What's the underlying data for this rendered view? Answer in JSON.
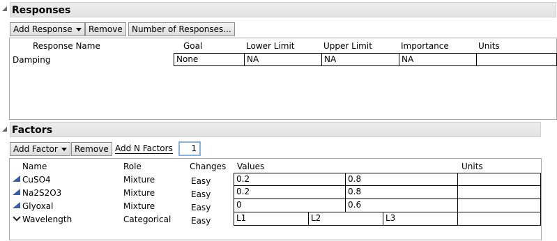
{
  "responses": {
    "title": "Responses",
    "add_label": "Add Response",
    "remove_label": "Remove",
    "number_label": "Number of Responses...",
    "columns": [
      "Response Name",
      "Goal",
      "Lower Limit",
      "Upper Limit",
      "Importance",
      "Units"
    ],
    "rows": [
      {
        "name": "Damping",
        "goal": "None",
        "lower": "NA",
        "upper": "NA",
        "importance": "NA",
        "units": ""
      }
    ]
  },
  "factors": {
    "title": "Factors",
    "add_label": "Add Factor",
    "remove_label": "Remove",
    "add_n_label": "Add N Factors",
    "add_n_value": "1",
    "columns": [
      "Name",
      "Role",
      "Changes",
      "Values",
      "Units"
    ],
    "rows": [
      {
        "name": "CuSO4",
        "icon": "continuous-mixture-icon",
        "role": "Mixture",
        "changes": "Easy",
        "values": [
          "0.2",
          "0.8"
        ]
      },
      {
        "name": "Na2S2O3",
        "icon": "continuous-mixture-icon",
        "role": "Mixture",
        "changes": "Easy",
        "values": [
          "0.2",
          "0.8"
        ]
      },
      {
        "name": "Glyoxal",
        "icon": "continuous-mixture-icon",
        "role": "Mixture",
        "changes": "Easy",
        "values": [
          "0",
          "0.6"
        ]
      },
      {
        "name": "Wavelength",
        "icon": "categorical-chevron-icon",
        "role": "Categorical",
        "changes": "Easy",
        "values": [
          "L1",
          "L2",
          "L3"
        ]
      }
    ]
  }
}
